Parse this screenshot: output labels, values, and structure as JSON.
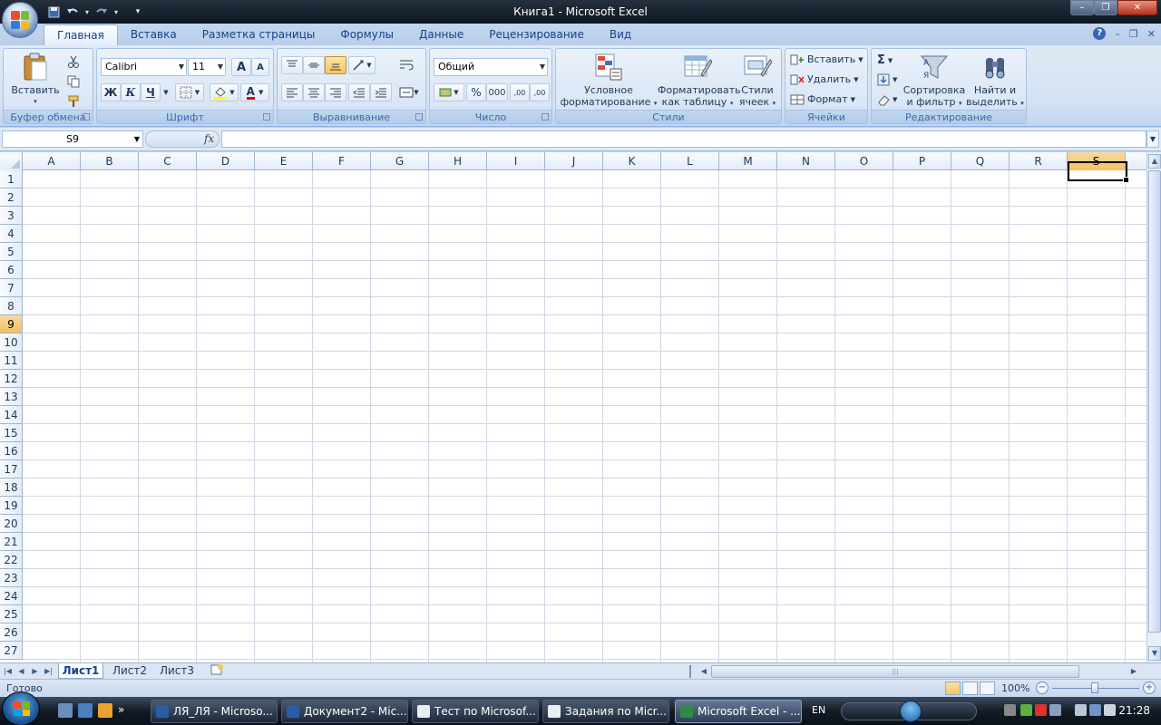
{
  "window": {
    "title": "Книга1 - Microsoft Excel",
    "controls": {
      "minimize": "–",
      "restore": "❐",
      "close": "✕"
    }
  },
  "quick_access": {
    "save_icon": "save-icon",
    "undo_icon": "undo-icon",
    "redo_icon": "redo-icon",
    "customize": "▾"
  },
  "tabs": [
    {
      "label": "Главная",
      "active": true
    },
    {
      "label": "Вставка"
    },
    {
      "label": "Разметка страницы"
    },
    {
      "label": "Формулы"
    },
    {
      "label": "Данные"
    },
    {
      "label": "Рецензирование"
    },
    {
      "label": "Вид"
    }
  ],
  "ribbon": {
    "clipboard": {
      "label": "Буфер обмена",
      "paste": "Вставить"
    },
    "font": {
      "label": "Шрифт",
      "name": "Calibri",
      "size": "11",
      "bold": "Ж",
      "italic": "К",
      "underline": "Ч",
      "grow": "A",
      "shrink": "A",
      "font_color": "A"
    },
    "alignment": {
      "label": "Выравнивание"
    },
    "number": {
      "label": "Число",
      "format": "Общий",
      "percent": "%",
      "thousands": "000",
      "inc_decimal": ",00",
      "dec_decimal": ",00"
    },
    "styles": {
      "label": "Стили",
      "conditional_line1": "Условное",
      "conditional_line2": "форматирование",
      "table_line1": "Форматировать",
      "table_line2": "как таблицу",
      "cell_line1": "Стили",
      "cell_line2": "ячеек"
    },
    "cells": {
      "label": "Ячейки",
      "insert": "Вставить",
      "delete": "Удалить",
      "format": "Формат"
    },
    "editing": {
      "label": "Редактирование",
      "sigma": "Σ",
      "sort_line1": "Сортировка",
      "sort_line2": "и фильтр",
      "find_line1": "Найти и",
      "find_line2": "выделить"
    }
  },
  "formula_bar": {
    "name_box": "S9",
    "fx": "fx",
    "formula": ""
  },
  "grid": {
    "columns": [
      "A",
      "B",
      "C",
      "D",
      "E",
      "F",
      "G",
      "H",
      "I",
      "J",
      "K",
      "L",
      "M",
      "N",
      "O",
      "P",
      "Q",
      "R",
      "S"
    ],
    "rows": [
      "1",
      "2",
      "3",
      "4",
      "5",
      "6",
      "7",
      "8",
      "9",
      "10",
      "11",
      "12",
      "13",
      "14",
      "15",
      "16",
      "17",
      "18",
      "19",
      "20",
      "21",
      "22",
      "23",
      "24",
      "25",
      "26",
      "27"
    ],
    "selected_column": "S",
    "selected_row": "9"
  },
  "sheets": [
    {
      "label": "Лист1",
      "active": true
    },
    {
      "label": "Лист2"
    },
    {
      "label": "Лист3"
    }
  ],
  "status": {
    "text": "Готово",
    "zoom": "100%"
  },
  "taskbar": {
    "buttons": [
      {
        "label": "ЛЯ_ЛЯ - Microso..."
      },
      {
        "label": "Документ2 - Mic..."
      },
      {
        "label": "Тест по Microsof..."
      },
      {
        "label": "Задания по Micr..."
      },
      {
        "label": "Microsoft Excel - ...",
        "active": true
      }
    ],
    "language": "EN",
    "clock": "21:28",
    "more": "»"
  }
}
